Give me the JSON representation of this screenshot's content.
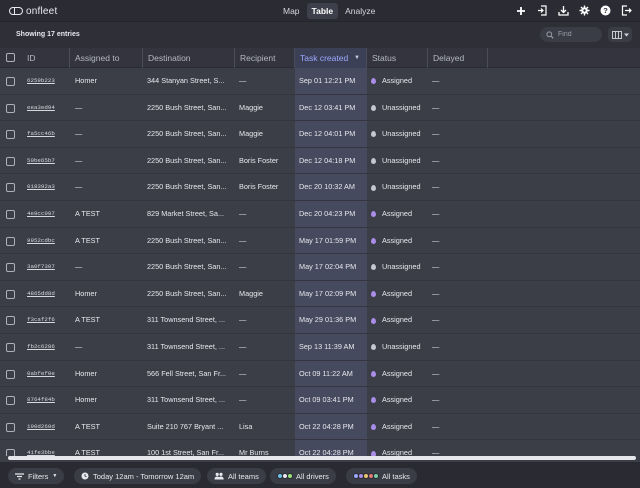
{
  "app": {
    "name": "onfleet"
  },
  "nav": {
    "tabs": [
      {
        "label": "Map"
      },
      {
        "label": "Table"
      },
      {
        "label": "Analyze"
      }
    ],
    "active": "Table"
  },
  "toolbar": {
    "icons": [
      "plus-icon",
      "import-icon",
      "download-icon",
      "settings-icon",
      "help-icon",
      "logout-icon"
    ]
  },
  "subbar": {
    "entries_text": "Showing 17 entries",
    "search_placeholder": "Find"
  },
  "table": {
    "columns": [
      "ID",
      "Assigned to",
      "Destination",
      "Recipient",
      "Task created",
      "Status",
      "Delayed"
    ],
    "sorted_column": "Task created",
    "rows": [
      {
        "id": "6259b223",
        "assigned": "Homer",
        "destination": "344 Stanyan Street, S...",
        "recipient": "—",
        "created": "Sep 01 12:21 PM",
        "status": "Assigned",
        "delayed": "—"
      },
      {
        "id": "eea3ed94",
        "assigned": "—",
        "destination": "2250 Bush Street, San...",
        "recipient": "Maggie",
        "created": "Dec 12 03:41 PM",
        "status": "Unassigned",
        "delayed": "—"
      },
      {
        "id": "fa5cc46b",
        "assigned": "—",
        "destination": "2250 Bush Street, San...",
        "recipient": "Maggie",
        "created": "Dec 12 04:01 PM",
        "status": "Unassigned",
        "delayed": "—"
      },
      {
        "id": "50be65b7",
        "assigned": "—",
        "destination": "2250 Bush Street, San...",
        "recipient": "Boris Foster",
        "created": "Dec 12 04:18 PM",
        "status": "Unassigned",
        "delayed": "—"
      },
      {
        "id": "018392a3",
        "assigned": "—",
        "destination": "2250 Bush Street, San...",
        "recipient": "Boris Foster",
        "created": "Dec 20 10:32 AM",
        "status": "Unassigned",
        "delayed": "—"
      },
      {
        "id": "4e9cc097",
        "assigned": "A TEST",
        "destination": "829 Market Street, Sa...",
        "recipient": "—",
        "created": "Dec 20 04:23 PM",
        "status": "Assigned",
        "delayed": "—"
      },
      {
        "id": "9952cdbc",
        "assigned": "A TEST",
        "destination": "2250 Bush Street, San...",
        "recipient": "—",
        "created": "May 17 01:59 PM",
        "status": "Assigned",
        "delayed": "—"
      },
      {
        "id": "3a0f7307",
        "assigned": "—",
        "destination": "2250 Bush Street, San...",
        "recipient": "—",
        "created": "May 17 02:04 PM",
        "status": "Unassigned",
        "delayed": "—"
      },
      {
        "id": "4865dd8d",
        "assigned": "Homer",
        "destination": "2250 Bush Street, San...",
        "recipient": "Maggie",
        "created": "May 17 02:09 PM",
        "status": "Assigned",
        "delayed": "—"
      },
      {
        "id": "f3caf2f6",
        "assigned": "A TEST",
        "destination": "311 Townsend Street, ...",
        "recipient": "—",
        "created": "May 29 01:36 PM",
        "status": "Assigned",
        "delayed": "—"
      },
      {
        "id": "fb2c6286",
        "assigned": "—",
        "destination": "311 Townsend Street, ...",
        "recipient": "—",
        "created": "Sep 13 11:39 AM",
        "status": "Unassigned",
        "delayed": "—"
      },
      {
        "id": "0abfef0e",
        "assigned": "Homer",
        "destination": "566 Fell Street, San Fr...",
        "recipient": "—",
        "created": "Oct 09 11:22 AM",
        "status": "Assigned",
        "delayed": "—"
      },
      {
        "id": "8764f84b",
        "assigned": "Homer",
        "destination": "311 Townsend Street, ...",
        "recipient": "—",
        "created": "Oct 09 03:41 PM",
        "status": "Assigned",
        "delayed": "—"
      },
      {
        "id": "190d260d",
        "assigned": "A TEST",
        "destination": "Suite 210 767 Bryant ...",
        "recipient": "Lisa",
        "created": "Oct 22 04:28 PM",
        "status": "Assigned",
        "delayed": "—"
      },
      {
        "id": "41fe3bbe",
        "assigned": "A TEST",
        "destination": "100 1st Street, San Fr...",
        "recipient": "Mr Burns",
        "created": "Oct 22 04:28 PM",
        "status": "Assigned",
        "delayed": "—"
      }
    ]
  },
  "bottombar": {
    "filters_label": "Filters",
    "date_range_label": "Today 12am - Tomorrow 12am",
    "teams_label": "All teams",
    "drivers_label": "All drivers",
    "tasks_label": "All tasks"
  },
  "colors": {
    "assigned": "#a98de8",
    "unassigned": "#c4c6d0",
    "sort_accent": "#9aa8ff"
  }
}
